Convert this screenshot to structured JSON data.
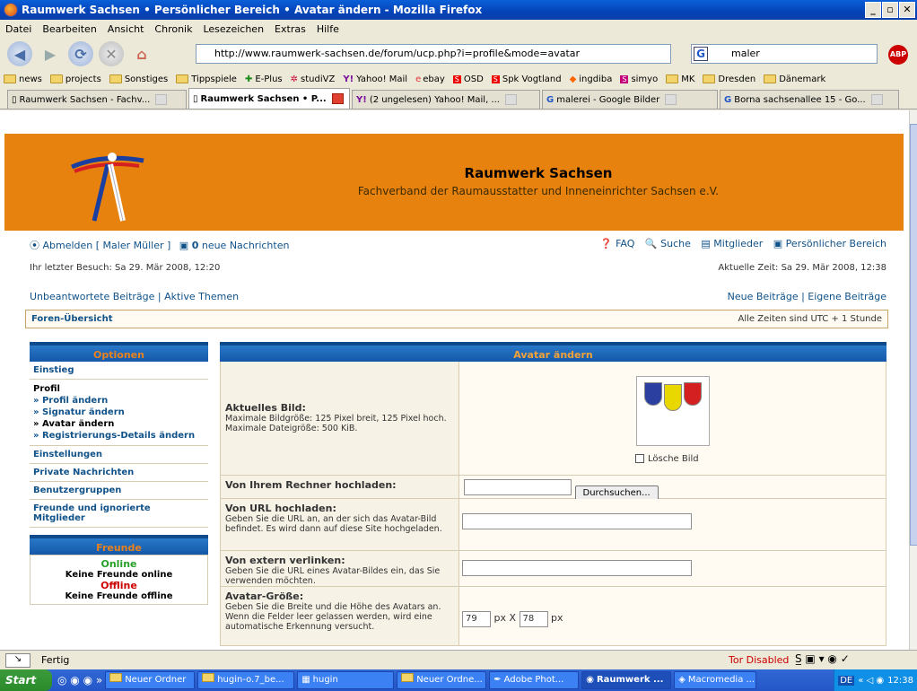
{
  "window": {
    "title": "Raumwerk Sachsen • Persönlicher Bereich • Avatar ändern - Mozilla Firefox"
  },
  "menu": [
    "Datei",
    "Bearbeiten",
    "Ansicht",
    "Chronik",
    "Lesezeichen",
    "Extras",
    "Hilfe"
  ],
  "nav": {
    "url": "http://www.raumwerk-sachsen.de/forum/ucp.php?i=profile&mode=avatar",
    "search_value": "maler",
    "search_engine": "G"
  },
  "bookmarks": [
    "news",
    "projects",
    "Sonstiges",
    "Tippspiele",
    "E-Plus",
    "studiVZ",
    "Yahoo! Mail",
    "ebay",
    "OSD",
    "Spk Vogtland",
    "ingdiba",
    "simyo",
    "MK",
    "Dresden",
    "Dänemark"
  ],
  "tabs": [
    {
      "label": "Raumwerk Sachsen - Fachv...",
      "active": false
    },
    {
      "label": "Raumwerk Sachsen • P...",
      "active": true
    },
    {
      "label": "(2 ungelesen) Yahoo! Mail, ...",
      "active": false
    },
    {
      "label": "malerei - Google Bilder",
      "active": false
    },
    {
      "label": "Borna sachsenallee 15 - Go...",
      "active": false
    }
  ],
  "site": {
    "title": "Raumwerk Sachsen",
    "subtitle": "Fachverband der Raumausstatter und Inneneinrichter Sachsen e.V.",
    "logout": "Abmelden [ Maler Müller ]",
    "msg_count": "0",
    "msg_label": "neue Nachrichten",
    "faq": "FAQ",
    "search": "Suche",
    "members": "Mitglieder",
    "personal": "Persönlicher Bereich",
    "last_visit": "Ihr letzter Besuch: Sa 29. Mär 2008, 12:20",
    "current_time": "Aktuelle Zeit: Sa 29. Mär 2008, 12:38",
    "unanswered": "Unbeantwortete Beiträge",
    "active_topics": "Aktive Themen",
    "new_posts": "Neue Beiträge",
    "own_posts": "Eigene Beiträge",
    "breadcrumb": "Foren-Übersicht",
    "timezone": "Alle Zeiten sind UTC + 1 Stunde"
  },
  "sidebar": {
    "head": "Optionen",
    "einstieg": "Einstieg",
    "profil": "Profil",
    "profil_items": [
      "» Profil ändern",
      "» Signatur ändern",
      "» Avatar ändern",
      "» Registrierungs-Details ändern"
    ],
    "settings": "Einstellungen",
    "pm": "Private Nachrichten",
    "groups": "Benutzergruppen",
    "friends_foes": "Freunde und ignorierte Mitglieder",
    "friends_head": "Freunde",
    "online": "Online",
    "no_online": "Keine Freunde online",
    "offline": "Offline",
    "no_offline": "Keine Freunde offline"
  },
  "avatar": {
    "head": "Avatar ändern",
    "current_title": "Aktuelles Bild:",
    "current_desc": "Maximale Bildgröße: 125 Pixel breit, 125 Pixel hoch. Maximale Dateigröße: 500 KiB.",
    "delete_label": "Lösche Bild",
    "upload_title": "Von Ihrem Rechner hochladen:",
    "browse_button": "Durchsuchen...",
    "url_title": "Von URL hochladen:",
    "url_desc": "Geben Sie die URL an, an der sich das Avatar-Bild befindet. Es wird dann auf diese Site hochgeladen.",
    "link_title": "Von extern verlinken:",
    "link_desc": "Geben Sie die URL eines Avatar-Bildes ein, das Sie verwenden möchten.",
    "size_title": "Avatar-Größe:",
    "size_desc": "Geben Sie die Breite und die Höhe des Avatars an. Wenn die Felder leer gelassen werden, wird eine automatische Erkennung versucht.",
    "width": "79",
    "height": "78",
    "px": "px",
    "x": "X",
    "shield_colors": [
      "#2a3fa0",
      "#e8d800",
      "#d42020"
    ]
  },
  "status": {
    "text": "Fertig",
    "tor": "Tor Disabled"
  },
  "taskbar": {
    "start": "Start",
    "items": [
      "Neuer Ordner",
      "hugin-o.7_be...",
      "hugin",
      "Neuer Ordne...",
      "Adobe Phot...",
      "Raumwerk ...",
      "Macromedia ..."
    ],
    "clock": "12:38",
    "lang": "DE"
  }
}
